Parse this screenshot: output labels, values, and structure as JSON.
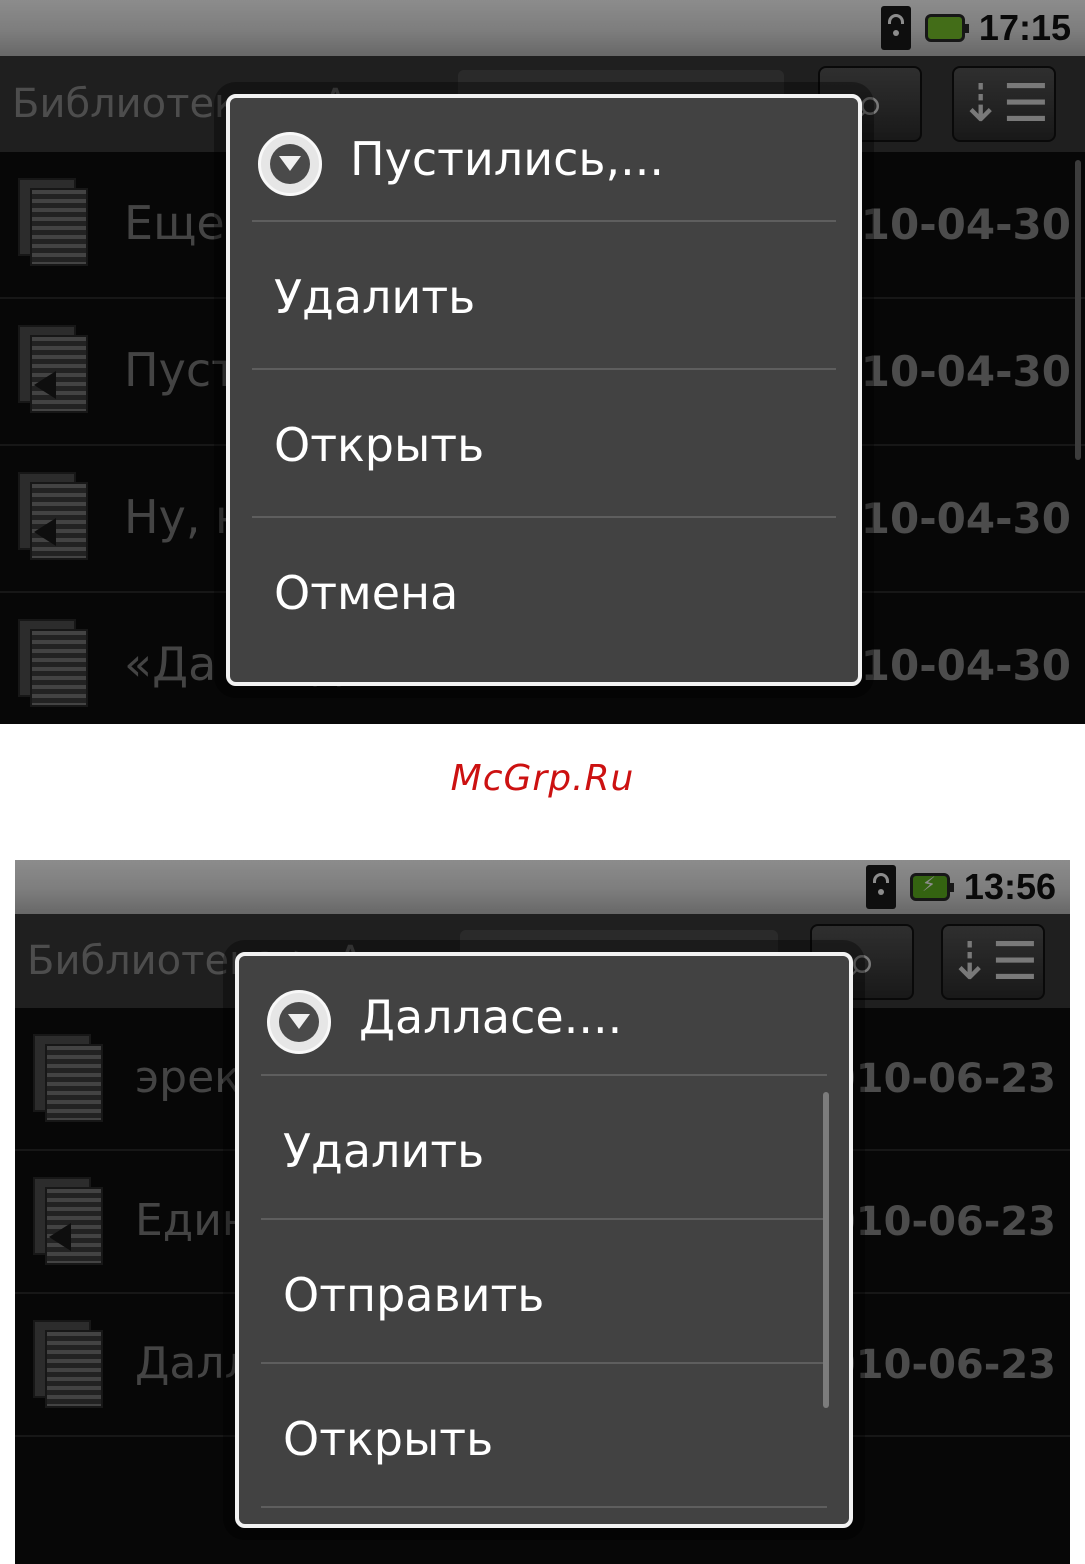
{
  "screen1": {
    "status": {
      "time": "17:15",
      "signal_icon": "wifi-signal-icon",
      "battery_icon": "battery-icon"
    },
    "titlebar": {
      "breadcrumb": "Библиотека > Аннота природа",
      "search_icon": "search-icon",
      "sort_icon": "sort-icon"
    },
    "list": [
      {
        "title": "Еще бы!.. ...",
        "date": "2010-04-30",
        "icon": "document-icon"
      },
      {
        "title": "Пустились,...",
        "date": "2010-04-30",
        "icon": "audio-document-icon"
      },
      {
        "title": "Ну, нет, о...",
        "date": "2010-04-30",
        "icon": "audio-document-icon"
      },
      {
        "title": "«Да когда ...",
        "date": "2010-04-30",
        "icon": "document-icon"
      }
    ],
    "dialog": {
      "title": "Пустились,...",
      "items": [
        "Удалить",
        "Открыть",
        "Отмена"
      ]
    }
  },
  "watermark": "McGrp.Ru",
  "screen2": {
    "status": {
      "time": "13:56",
      "signal_icon": "wifi-signal-icon",
      "battery_icon": "battery-charging-icon"
    },
    "titlebar": {
      "breadcrumb": "Библиотека > Анн...",
      "search_icon": "search-icon",
      "sort_icon": "sort-icon"
    },
    "list": [
      {
        "title": "эрекция",
        "date": "2010-06-23",
        "icon": "document-icon"
      },
      {
        "title": "Единственн...",
        "date": "2010-06-23",
        "icon": "audio-document-icon"
      },
      {
        "title": "Далласе. Е...",
        "date": "2010-06-23",
        "icon": "document-icon"
      }
    ],
    "dialog": {
      "title": "Далласе....",
      "items": [
        "Удалить",
        "Отправить",
        "Открыть"
      ]
    }
  }
}
